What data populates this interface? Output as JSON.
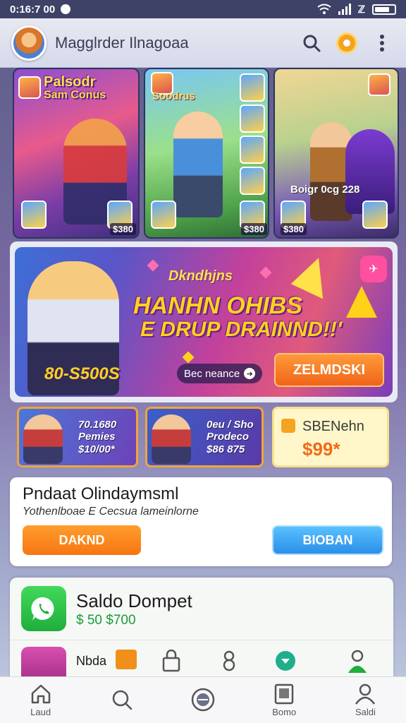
{
  "status_bar": {
    "time": "0:16:7 00",
    "network": "ℤ"
  },
  "header": {
    "title": "Magglrder Ilnagoaa"
  },
  "game_tiles": [
    {
      "title": "Palsodr",
      "subtitle": "Sam Conus",
      "price": "$380"
    },
    {
      "title": "Soodrus",
      "price": "$380"
    },
    {
      "title": "Boigr 0cg 228",
      "price": "$380"
    }
  ],
  "banner": {
    "small_text": "Dkndhjns",
    "headline": "HANHN OHIBS",
    "subheadline": "E DRUP DRAINND!!'",
    "price": "80-S500S",
    "pill_text": "Bec neance",
    "button_label": "ZELMDSKI"
  },
  "offers": [
    {
      "line1": "70.1680",
      "line2": "Pemies",
      "line3": "$10/00*"
    },
    {
      "line1": "0eu / Sho",
      "line2": "Prodeco",
      "line3": "$86 875"
    },
    {
      "title": "SBENehn",
      "price": "$99*"
    }
  ],
  "product": {
    "title": "Pndaat Olindaymsml",
    "subtitle": "Yothenlboae E Cecsua lameinlorne",
    "primary_button": "DAKND",
    "secondary_button": "BIOBAN"
  },
  "wallet": {
    "title": "Saldo Dompet",
    "amount": "$ 50 $700",
    "mini_label": "Nbda"
  },
  "bottom_nav": [
    {
      "label": "Laud",
      "icon": "home-icon"
    },
    {
      "label": "",
      "icon": "search-icon"
    },
    {
      "label": "",
      "icon": "games-icon"
    },
    {
      "label": "Bomo",
      "icon": "book-icon"
    },
    {
      "label": "Saldi",
      "icon": "profile-icon"
    }
  ],
  "colors": {
    "accent_orange": "#f77611",
    "accent_blue": "#2b8fe8",
    "wallet_green": "#1fae3c",
    "header_bg": "#3e4266"
  }
}
